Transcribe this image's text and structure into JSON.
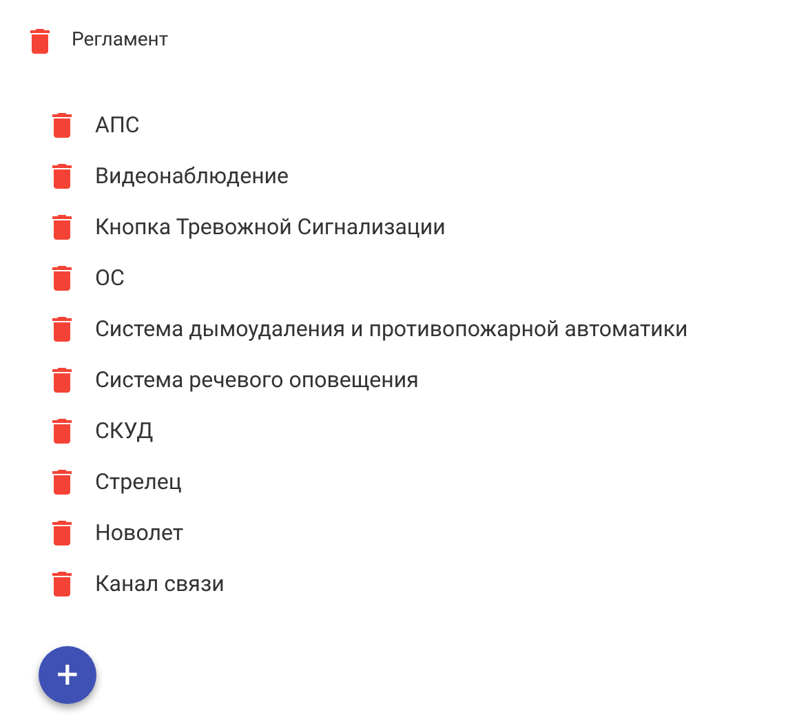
{
  "header": {
    "label": "Регламент"
  },
  "items": [
    {
      "label": "АПС"
    },
    {
      "label": "Видеонаблюдение"
    },
    {
      "label": "Кнопка Тревожной Сигнализации"
    },
    {
      "label": "ОС"
    },
    {
      "label": "Система дымоудаления и противопожарной автоматики"
    },
    {
      "label": "Система речевого оповещения"
    },
    {
      "label": "СКУД"
    },
    {
      "label": "Стрелец"
    },
    {
      "label": "Новолет"
    },
    {
      "label": "Канал связи"
    }
  ],
  "add_button": {
    "label": "+"
  }
}
